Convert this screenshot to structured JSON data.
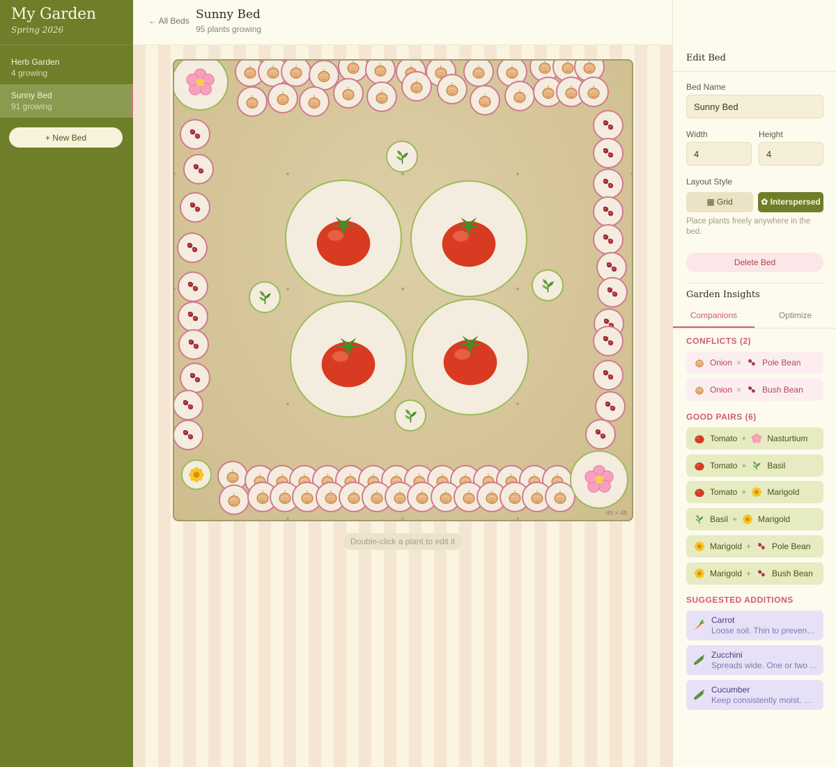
{
  "app": {
    "title": "My Garden",
    "subtitle": "Spring 2026"
  },
  "beds": [
    {
      "name": "Herb Garden",
      "count": "4 growing",
      "active": false
    },
    {
      "name": "Sunny Bed",
      "count": "91 growing",
      "active": true
    }
  ],
  "sidebar": {
    "new_bed_label": "+ New Bed"
  },
  "header": {
    "back_label": "← All Beds",
    "title": "Sunny Bed",
    "subtitle": "95 plants growing"
  },
  "canvas": {
    "dims_label": "4ft × 4ft",
    "hint": "Double-click a plant to edit it"
  },
  "edit_bed": {
    "title": "Edit Bed",
    "name_label": "Bed Name",
    "name_value": "Sunny Bed",
    "width_label": "Width",
    "width_value": "4",
    "height_label": "Height",
    "height_value": "4",
    "layout_label": "Layout Style",
    "grid_label": "▦ Grid",
    "interspersed_label": "✿ Interspersed",
    "layout_selected": "Interspersed",
    "layout_hint": "Place plants freely anywhere in the bed.",
    "delete_label": "Delete Bed"
  },
  "insights": {
    "title": "Garden Insights",
    "tabs": [
      "Companions",
      "Optimize"
    ],
    "active_tab": "Companions",
    "conflicts_title": "CONFLICTS (2)",
    "conflicts": [
      {
        "a": "Onion",
        "a_icon": "onion-icon",
        "b": "Pole Bean",
        "b_icon": "bean-icon"
      },
      {
        "a": "Onion",
        "a_icon": "onion-icon",
        "b": "Bush Bean",
        "b_icon": "bean-icon"
      }
    ],
    "good_title": "GOOD PAIRS (6)",
    "good_pairs": [
      {
        "a": "Tomato",
        "a_icon": "tomato-icon",
        "b": "Nasturtium",
        "b_icon": "flower-icon"
      },
      {
        "a": "Tomato",
        "a_icon": "tomato-icon",
        "b": "Basil",
        "b_icon": "basil-icon"
      },
      {
        "a": "Tomato",
        "a_icon": "tomato-icon",
        "b": "Marigold",
        "b_icon": "marigold-icon"
      },
      {
        "a": "Basil",
        "a_icon": "basil-icon",
        "b": "Marigold",
        "b_icon": "marigold-icon"
      },
      {
        "a": "Marigold",
        "a_icon": "marigold-icon",
        "b": "Pole Bean",
        "b_icon": "bean-icon"
      },
      {
        "a": "Marigold",
        "a_icon": "marigold-icon",
        "b": "Bush Bean",
        "b_icon": "bean-icon"
      }
    ],
    "suggest_title": "SUGGESTED ADDITIONS",
    "suggestions": [
      {
        "name": "Carrot",
        "desc": "Loose soil. Thin to prevent ...",
        "icon": "carrot-icon"
      },
      {
        "name": "Zucchini",
        "desc": "Spreads wide. One or two ...",
        "icon": "zucchini-icon"
      },
      {
        "name": "Cucumber",
        "desc": "Keep consistently moist. M...",
        "icon": "cucumber-icon"
      }
    ]
  },
  "colors": {
    "sidebar": "#6e7e29",
    "accent": "#cf5c75",
    "conflict_bg": "#fceef0",
    "good_bg": "#e6ebc2",
    "suggest_bg": "#e7e1f8"
  }
}
